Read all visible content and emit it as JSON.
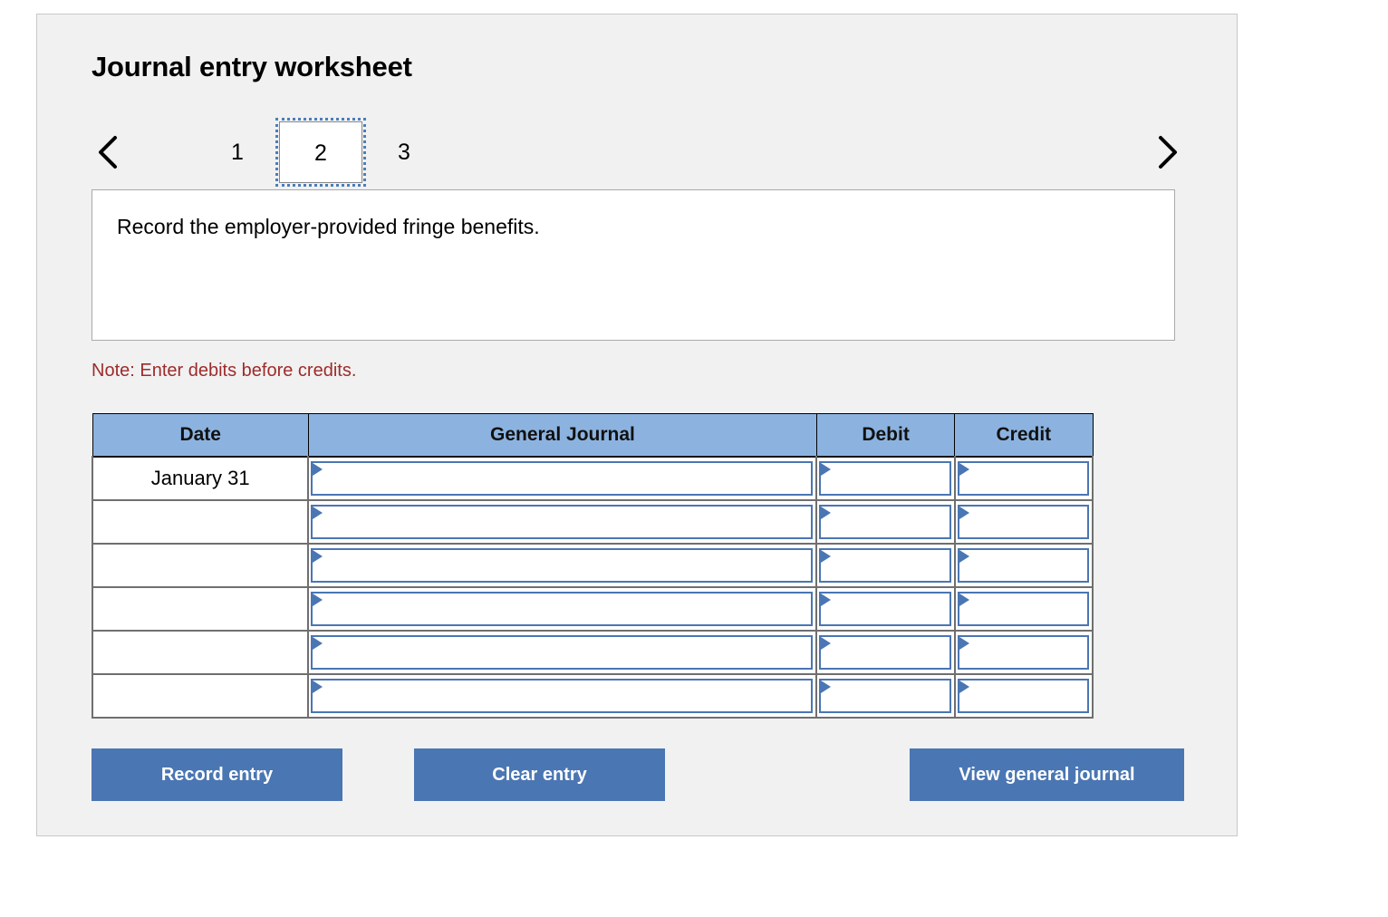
{
  "panel": {
    "title": "Journal entry worksheet"
  },
  "nav": {
    "prev_icon": "chevron-left-icon",
    "next_icon": "chevron-right-icon",
    "tabs": [
      {
        "label": "1",
        "selected": false
      },
      {
        "label": "2",
        "selected": true
      },
      {
        "label": "3",
        "selected": false
      }
    ]
  },
  "description": {
    "text": "Record the employer-provided fringe benefits."
  },
  "note": {
    "text": "Note: Enter debits before credits."
  },
  "table": {
    "headers": {
      "date": "Date",
      "general_journal": "General Journal",
      "debit": "Debit",
      "credit": "Credit"
    },
    "rows": [
      {
        "date": "January 31",
        "general_journal": "",
        "debit": "",
        "credit": ""
      },
      {
        "date": "",
        "general_journal": "",
        "debit": "",
        "credit": ""
      },
      {
        "date": "",
        "general_journal": "",
        "debit": "",
        "credit": ""
      },
      {
        "date": "",
        "general_journal": "",
        "debit": "",
        "credit": ""
      },
      {
        "date": "",
        "general_journal": "",
        "debit": "",
        "credit": ""
      },
      {
        "date": "",
        "general_journal": "",
        "debit": "",
        "credit": ""
      }
    ]
  },
  "buttons": {
    "record_entry": "Record entry",
    "clear_entry": "Clear entry",
    "view_general_journal": "View general journal"
  },
  "colors": {
    "panel_background": "#f1f1f1",
    "header_blue": "#8cb3e0",
    "button_blue": "#4a76b3",
    "note_red": "#9e2b2b",
    "cell_border_blue": "#4a76b3",
    "focus_ring_blue": "#4a7ebb"
  }
}
